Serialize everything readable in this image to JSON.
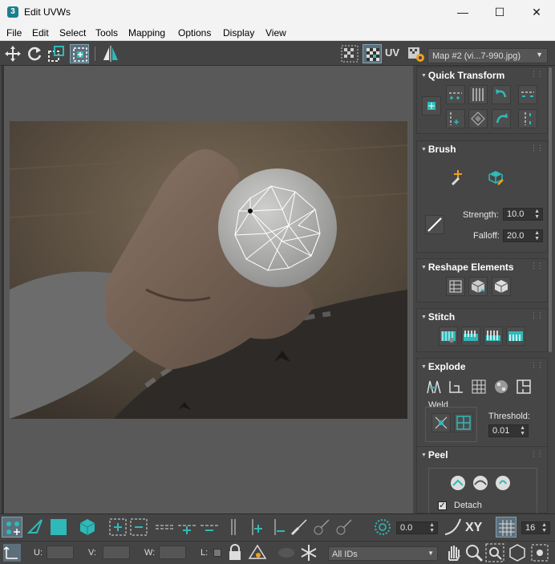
{
  "window": {
    "title": "Edit UVWs",
    "app_icon": "3",
    "controls": {
      "minimize": "—",
      "maximize": "☐",
      "close": "✕"
    }
  },
  "menu": [
    "File",
    "Edit",
    "Select",
    "Tools",
    "Mapping",
    "Options",
    "Display",
    "View"
  ],
  "toolbar": {
    "uv_label": "UV",
    "map_selector": "Map #2 (vi...7-990.jpg)",
    "icons": [
      "move-icon",
      "rotate-icon",
      "scale-icon",
      "freeform-icon",
      "mirror-icon",
      "checker-icon",
      "checker-display-icon",
      "settings-map-icon"
    ]
  },
  "panel": {
    "quick_transform": {
      "title": "Quick Transform"
    },
    "brush": {
      "title": "Brush",
      "strength_label": "Strength:",
      "strength_value": "10.0",
      "falloff_label": "Falloff:",
      "falloff_value": "20.0"
    },
    "reshape": {
      "title": "Reshape Elements"
    },
    "stitch": {
      "title": "Stitch"
    },
    "explode": {
      "title": "Explode",
      "weld_label": "Weld",
      "threshold_label": "Threshold:",
      "threshold_value": "0.01"
    },
    "peel": {
      "title": "Peel",
      "detach_label": "Detach",
      "detach_checked": true
    }
  },
  "bottom_toolbar": {
    "angle_value": "0.0",
    "xy_label": "XY",
    "grid_value": "16"
  },
  "status": {
    "u_label": "U:",
    "v_label": "V:",
    "w_label": "W:",
    "l_label": "L:",
    "u_value": "",
    "v_value": "",
    "w_value": "",
    "ids_select": "All IDs"
  },
  "colors": {
    "accent": "#2fb9b9",
    "panel": "#444444",
    "viewport": "#595959"
  }
}
